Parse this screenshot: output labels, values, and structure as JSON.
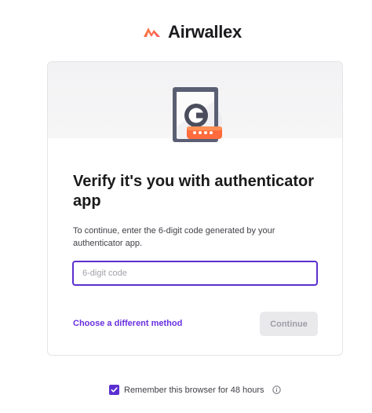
{
  "brand": {
    "name": "Airwallex",
    "logo_icon": "airwallex-logo-icon",
    "accent_color": "#ff6b3d"
  },
  "card": {
    "hero_icon": "authenticator-device-icon",
    "title": "Verify it's you with authenticator app",
    "description": "To continue, enter the 6-digit code generated by your authenticator app.",
    "code_input": {
      "placeholder": "6-digit code",
      "value": ""
    },
    "alternate_method_label": "Choose a different method",
    "continue_label": "Continue",
    "continue_enabled": false
  },
  "remember": {
    "label": "Remember this browser for 48 hours",
    "checked": true,
    "info_icon": "info-icon"
  },
  "colors": {
    "primary": "#5b2fd0",
    "link": "#6a2fe0",
    "disabled_bg": "#e9e9ec"
  }
}
